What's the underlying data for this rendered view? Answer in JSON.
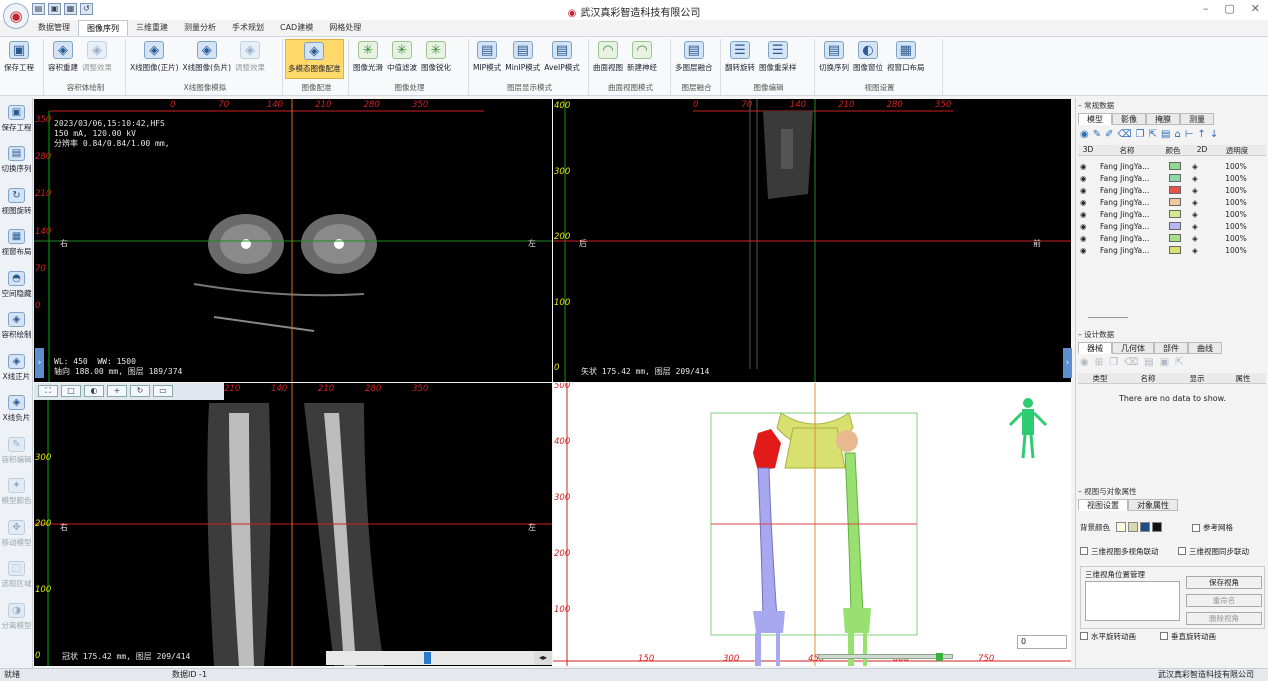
{
  "app": {
    "title": "武汉真彩智造科技有限公司"
  },
  "tabs": [
    "数据管理",
    "图像序列",
    "三维重建",
    "测量分析",
    "手术规划",
    "CAD建模",
    "网格处理"
  ],
  "ribbon": [
    {
      "label": "",
      "buttons": [
        {
          "label": "保存工程",
          "icon": "save-icon"
        }
      ]
    },
    {
      "label": "容积体绘制",
      "buttons": [
        {
          "label": "容积重建",
          "icon": "volume-icon"
        },
        {
          "label": "调整效果",
          "icon": "adjust-icon",
          "disabled": true
        }
      ]
    },
    {
      "label": "X线图像模拟",
      "buttons": [
        {
          "label": "X线图像(正片)",
          "icon": "xray-icon"
        },
        {
          "label": "X线图像(负片)",
          "icon": "xray-icon"
        },
        {
          "label": "调整效果",
          "icon": "adjust-icon",
          "disabled": true
        }
      ]
    },
    {
      "label": "图像配准",
      "buttons": [
        {
          "label": "多模态图像配准",
          "icon": "register-icon",
          "highlight": true
        }
      ]
    },
    {
      "label": "图像处理",
      "buttons": [
        {
          "label": "图像光滑",
          "icon": "smooth-icon"
        },
        {
          "label": "中值滤波",
          "icon": "filter-icon"
        },
        {
          "label": "图像锐化",
          "icon": "sharpen-icon"
        }
      ]
    },
    {
      "label": "图层显示模式",
      "buttons": [
        {
          "label": "MIP模式",
          "icon": "layer-icon"
        },
        {
          "label": "MinIP模式",
          "icon": "layer-icon"
        },
        {
          "label": "AveIP模式",
          "icon": "layer-icon"
        }
      ]
    },
    {
      "label": "曲面视图模式",
      "buttons": [
        {
          "label": "曲面视图",
          "icon": "curve-icon"
        },
        {
          "label": "新建神经",
          "icon": "nerve-icon"
        }
      ]
    },
    {
      "label": "图层融合",
      "buttons": [
        {
          "label": "多图层融合",
          "icon": "fusion-icon"
        }
      ]
    },
    {
      "label": "图像编辑",
      "buttons": [
        {
          "label": "翻转旋转",
          "icon": "flip-icon"
        },
        {
          "label": "图像重采样",
          "icon": "resample-icon"
        }
      ]
    },
    {
      "label": "视图设置",
      "buttons": [
        {
          "label": "切换序列",
          "icon": "series-icon"
        },
        {
          "label": "图像窗位",
          "icon": "window-icon"
        },
        {
          "label": "视窗口布局",
          "icon": "grid-icon"
        }
      ]
    }
  ],
  "leftbar": [
    {
      "label": "保存工程",
      "icon": "save-icon"
    },
    {
      "label": "切换序列",
      "icon": "series-icon"
    },
    {
      "label": "视图旋转",
      "icon": "rotate-icon"
    },
    {
      "label": "视窗布局",
      "icon": "grid-icon"
    },
    {
      "label": "空间隐藏",
      "icon": "hide-icon"
    },
    {
      "label": "容积绘制",
      "icon": "volume-icon"
    },
    {
      "label": "X线正片",
      "icon": "xray-icon"
    },
    {
      "label": "X线负片",
      "icon": "xray-icon"
    },
    {
      "label": "容积编辑",
      "icon": "edit-icon",
      "disabled": true
    },
    {
      "label": "模型颜色",
      "icon": "palette-icon",
      "disabled": true
    },
    {
      "label": "移动模型",
      "icon": "move-icon",
      "disabled": true
    },
    {
      "label": "选取区域",
      "icon": "select-icon",
      "disabled": true
    },
    {
      "label": "分离模型",
      "icon": "split-icon",
      "disabled": true
    }
  ],
  "axial": {
    "info": "2023/03/06,15:10:42,HFS\n150 mA, 120.00 kV\n分辨率 0.84/0.84/1.00 mm,",
    "wlww": "WL: 450  WW: 1500",
    "pos": "轴向 188.00 mm, 图层 189/374",
    "left": "右",
    "right": "左",
    "top_ticks": [
      "0",
      "70",
      "140",
      "210",
      "280",
      "350"
    ],
    "side_ticks": [
      "350",
      "280",
      "210",
      "140",
      "70",
      "0"
    ]
  },
  "sagittal": {
    "pos": "矢状 175.42 mm, 图层 209/414",
    "left": "后",
    "right": "前",
    "top_ticks": [
      "0",
      "70",
      "140",
      "210",
      "280",
      "350"
    ],
    "side_ticks": [
      "400",
      "300",
      "200",
      "100",
      "0"
    ]
  },
  "coronal": {
    "pos": "冠状 175.42 mm, 图层 209/414",
    "left": "右",
    "right": "左",
    "top_ticks": [
      "210",
      "140",
      "210",
      "280",
      "350"
    ],
    "side_ticks": [
      "300",
      "200",
      "100",
      "0"
    ]
  },
  "view3d": {
    "side_ticks": [
      "500",
      "400",
      "300",
      "200",
      "100"
    ],
    "bottom_ticks": [
      "150",
      "300",
      "450",
      "600",
      "750"
    ],
    "spin_value": "0"
  },
  "regular_data": {
    "header": "常规数据",
    "tabs": [
      "模型",
      "影像",
      "掩膜",
      "测量"
    ],
    "columns": [
      "3D",
      "名称",
      "颜色",
      "2D",
      "透明度"
    ],
    "rows": [
      {
        "name": "Fang JingYa...",
        "color": "#8fd88f",
        "opacity": "100%"
      },
      {
        "name": "Fang JingYa...",
        "color": "#8fd8a8",
        "opacity": "100%"
      },
      {
        "name": "Fang JingYa...",
        "color": "#e8504a",
        "opacity": "100%"
      },
      {
        "name": "Fang JingYa...",
        "color": "#f2c8a0",
        "opacity": "100%"
      },
      {
        "name": "Fang JingYa...",
        "color": "#d8e890",
        "opacity": "100%"
      },
      {
        "name": "Fang JingYa...",
        "color": "#b8b8f0",
        "opacity": "100%"
      },
      {
        "name": "Fang JingYa...",
        "color": "#a8e088",
        "opacity": "100%"
      },
      {
        "name": "Fang JingYa...",
        "color": "#d8e070",
        "opacity": "100%"
      }
    ]
  },
  "design_data": {
    "header": "设计数据",
    "tabs": [
      "器械",
      "几何体",
      "部件",
      "曲线"
    ],
    "columns": [
      "类型",
      "名称",
      "显示",
      "属性"
    ],
    "empty": "There are no data to show."
  },
  "view_props": {
    "header": "视图与对象属性",
    "tabs": [
      "视图设置",
      "对象属性"
    ],
    "bg_label": "背景颜色",
    "grid_label": "参考网格",
    "multi_link": "三维视图多视角联动",
    "sync_link": "三维视图同步联动",
    "angle_mgr": "三维视角位置管理",
    "save_btn": "保存视角",
    "rename_btn": "重命名",
    "delete_btn": "删除视角",
    "hrot": "水平旋转动画",
    "vrot": "垂直旋转动画"
  },
  "status": {
    "left": "就绪",
    "mid": "数据ID -1",
    "right": "武汉真彩智造科技有限公司"
  }
}
